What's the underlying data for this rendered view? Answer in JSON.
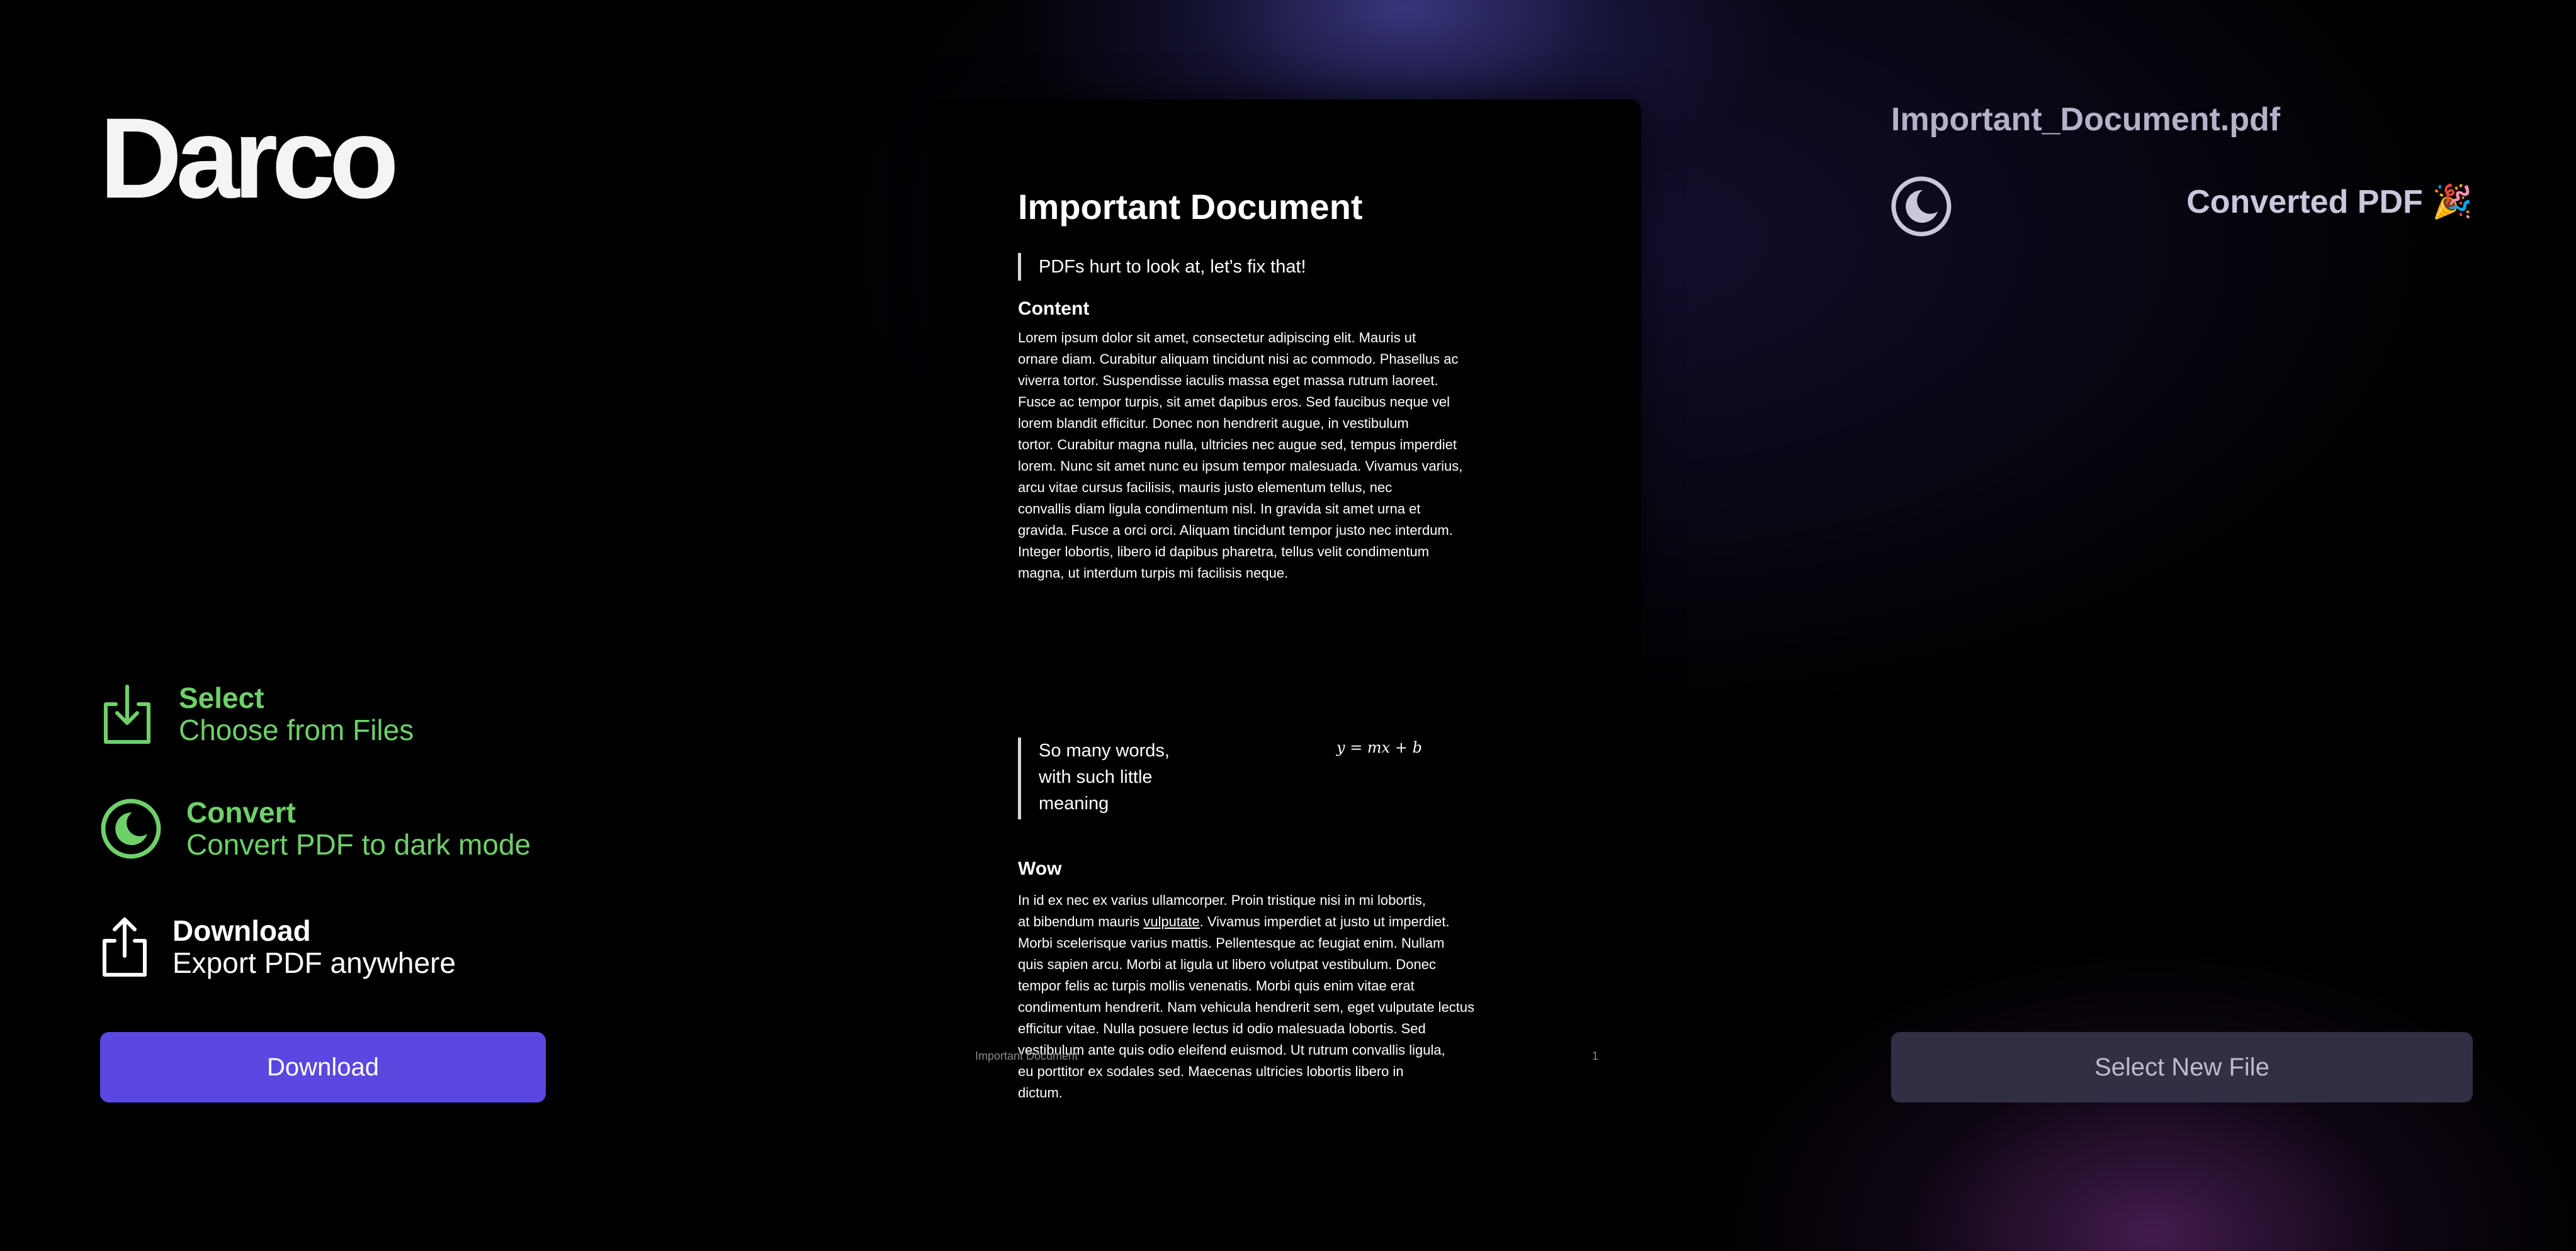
{
  "app": {
    "name": "Darco"
  },
  "steps": [
    {
      "title": "Select",
      "subtitle": "Choose from Files",
      "icon": "download-tray-icon",
      "state": "done"
    },
    {
      "title": "Convert",
      "subtitle": "Convert PDF to dark mode",
      "icon": "moon-icon",
      "state": "done"
    },
    {
      "title": "Download",
      "subtitle": "Export PDF anywhere",
      "icon": "share-icon",
      "state": "active"
    }
  ],
  "actions": {
    "download_label": "Download",
    "select_new_label": "Select New File"
  },
  "file": {
    "name": "Important_Document.pdf",
    "status": "Converted PDF 🎉"
  },
  "document": {
    "title": "Important Document",
    "quote": "PDFs hurt to look at, let's fix that!",
    "section1_heading": "Content",
    "section1_lines": [
      "Lorem ipsum dolor sit amet, consectetur adipiscing elit. Mauris ut",
      "ornare diam. Curabitur aliquam tincidunt nisi ac commodo. Phasellus ac",
      "viverra tortor. Suspendisse iaculis massa eget massa rutrum laoreet.",
      "Fusce ac tempor turpis, sit amet dapibus eros. Sed faucibus neque vel",
      "lorem blandit efficitur. Donec non hendrerit augue, in vestibulum",
      "tortor. Curabitur magna nulla, ultricies nec augue sed, tempus imperdiet",
      " lorem. Nunc sit amet nunc eu ipsum tempor malesuada. Vivamus varius,",
      "arcu vitae cursus facilisis, mauris justo elementum tellus, nec",
      "convallis diam ligula condimentum nisl. In gravida sit amet urna et",
      "gravida. Fusce a orci orci. Aliquam tincidunt tempor justo nec interdum.",
      " Integer lobortis, libero id dapibus pharetra, tellus velit condimentum",
      "magna, ut interdum turpis mi facilisis neque."
    ],
    "quote2_lines": [
      "So many words,",
      "with such little",
      "meaning"
    ],
    "formula": "y = mx + b",
    "section2_heading": "Wow",
    "section2_line1": "In id ex nec ex varius ullamcorper. Proin tristique nisi in mi lobortis,",
    "section2_line2_before": " at bibendum mauris ",
    "section2_line2_link": "vulputate",
    "section2_line2_after": ". Vivamus imperdiet at justo ut imperdiet.",
    "section2_rest": [
      "Morbi scelerisque varius mattis. Pellentesque ac feugiat enim. Nullam",
      "quis sapien arcu. Morbi at ligula ut libero volutpat vestibulum. Donec",
      "tempor felis ac turpis mollis venenatis. Morbi quis enim vitae erat",
      "condimentum hendrerit. Nam vehicula hendrerit sem, eget vulputate lectus",
      " efficitur vitae. Nulla posuere lectus id odio malesuada lobortis. Sed",
      "vestibulum ante quis odio eleifend euismod. Ut rutrum convallis ligula,",
      "eu porttitor ex sodales sed. Maecenas ultricies lobortis libero in",
      "dictum."
    ],
    "footer_title": "Important Document",
    "page_number": "1"
  },
  "colors": {
    "accent": "#5a48e0",
    "done": "#6fd06a",
    "secondary_button": "#322e44"
  }
}
